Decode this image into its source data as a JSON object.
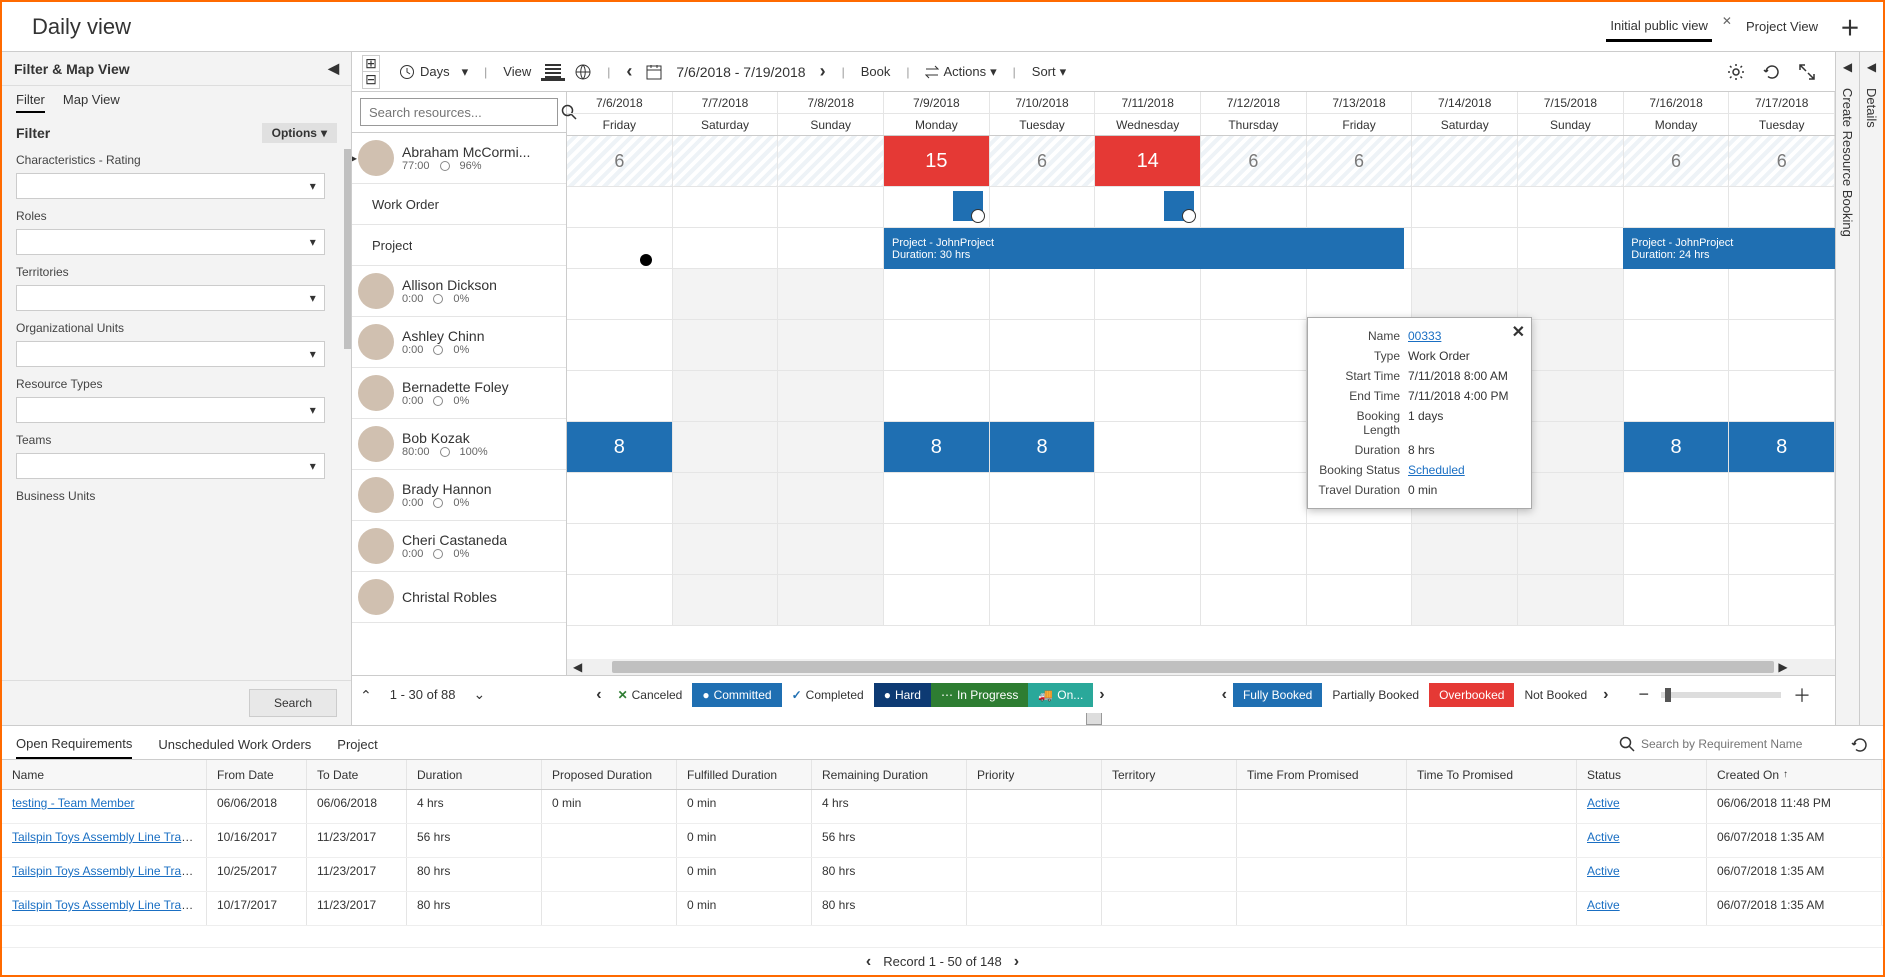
{
  "header": {
    "title": "Daily view",
    "tabs": [
      {
        "label": "Initial public view",
        "active": true,
        "closable": true
      },
      {
        "label": "Project View",
        "active": false,
        "closable": false
      }
    ]
  },
  "filterPanel": {
    "title": "Filter & Map View",
    "tabs": [
      "Filter",
      "Map View"
    ],
    "activeTab": "Filter",
    "sectionTitle": "Filter",
    "optionsLabel": "Options",
    "fields": [
      "Characteristics - Rating",
      "Roles",
      "Territories",
      "Organizational Units",
      "Resource Types",
      "Teams",
      "Business Units"
    ],
    "searchLabel": "Search"
  },
  "toolbar": {
    "timeUnit": "Days",
    "viewLabel": "View",
    "dateRange": "7/6/2018 - 7/19/2018",
    "bookLabel": "Book",
    "actionsLabel": "Actions",
    "sortLabel": "Sort"
  },
  "searchResourcesPlaceholder": "Search resources...",
  "dateColumns": [
    {
      "date": "7/6/2018",
      "day": "Friday"
    },
    {
      "date": "7/7/2018",
      "day": "Saturday"
    },
    {
      "date": "7/8/2018",
      "day": "Sunday"
    },
    {
      "date": "7/9/2018",
      "day": "Monday"
    },
    {
      "date": "7/10/2018",
      "day": "Tuesday"
    },
    {
      "date": "7/11/2018",
      "day": "Wednesday"
    },
    {
      "date": "7/12/2018",
      "day": "Thursday"
    },
    {
      "date": "7/13/2018",
      "day": "Friday"
    },
    {
      "date": "7/14/2018",
      "day": "Saturday"
    },
    {
      "date": "7/15/2018",
      "day": "Sunday"
    },
    {
      "date": "7/16/2018",
      "day": "Monday"
    },
    {
      "date": "7/17/2018",
      "day": "Tuesday"
    }
  ],
  "resources": [
    {
      "name": "Abraham McCormi...",
      "hours": "77:00",
      "pct": "96%",
      "expanded": true,
      "util": [
        "6",
        "",
        "",
        "15",
        "6",
        "14",
        "6",
        "6",
        "",
        "",
        "6",
        "6"
      ],
      "utilColor": [
        "",
        "",
        "",
        "red",
        "",
        "red",
        "",
        "",
        "",
        "",
        "",
        ""
      ],
      "subRows": [
        {
          "label": "Work Order"
        },
        {
          "label": "Project"
        }
      ]
    },
    {
      "name": "Allison Dickson",
      "hours": "0:00",
      "pct": "0%"
    },
    {
      "name": "Ashley Chinn",
      "hours": "0:00",
      "pct": "0%"
    },
    {
      "name": "Bernadette Foley",
      "hours": "0:00",
      "pct": "0%"
    },
    {
      "name": "Bob Kozak",
      "hours": "80:00",
      "pct": "100%",
      "util": [
        "8",
        "",
        "",
        "8",
        "8",
        "",
        "",
        "",
        "",
        "",
        "8",
        "8"
      ],
      "utilFill": [
        "blue",
        "gray",
        "gray",
        "blue",
        "blue",
        "",
        "",
        "",
        "gray",
        "gray",
        "blue",
        "blue"
      ]
    },
    {
      "name": "Brady Hannon",
      "hours": "0:00",
      "pct": "0%"
    },
    {
      "name": "Cheri Castaneda",
      "hours": "0:00",
      "pct": "0%"
    },
    {
      "name": "Christal Robles",
      "hours": "",
      "pct": ""
    }
  ],
  "projectBars": {
    "p1": {
      "title": "Project - JohnProject",
      "duration": "30 hrs",
      "durLabel": "Duration:"
    },
    "p2": {
      "title": "Project - JohnProject",
      "duration": "24 hrs",
      "durLabel": "Duration:"
    }
  },
  "tooltip": {
    "rows": [
      {
        "label": "Name",
        "value": "00333",
        "link": true
      },
      {
        "label": "Type",
        "value": "Work Order"
      },
      {
        "label": "Start Time",
        "value": "7/11/2018 8:00 AM"
      },
      {
        "label": "End Time",
        "value": "7/11/2018 4:00 PM"
      },
      {
        "label": "Booking Length",
        "value": "1 days"
      },
      {
        "label": "Duration",
        "value": "8 hrs"
      },
      {
        "label": "Booking Status",
        "value": "Scheduled",
        "link": true
      },
      {
        "label": "Travel Duration",
        "value": "0 min"
      }
    ]
  },
  "legend": {
    "pager": "1 - 30 of 88",
    "statuses": [
      "Canceled",
      "Committed",
      "Completed",
      "Hard",
      "In Progress",
      "On..."
    ],
    "booking": [
      "Fully Booked",
      "Partially Booked",
      "Overbooked",
      "Not Booked"
    ]
  },
  "bottom": {
    "tabs": [
      "Open Requirements",
      "Unscheduled Work Orders",
      "Project"
    ],
    "activeTab": "Open Requirements",
    "searchPlaceholder": "Search by Requirement Name",
    "columns": [
      "Name",
      "From Date",
      "To Date",
      "Duration",
      "Proposed Duration",
      "Fulfilled Duration",
      "Remaining Duration",
      "Priority",
      "Territory",
      "Time From Promised",
      "Time To Promised",
      "Status",
      "Created On"
    ],
    "rows": [
      {
        "name": "testing - Team Member",
        "from": "06/06/2018",
        "to": "06/06/2018",
        "dur": "4 hrs",
        "prop": "0 min",
        "ful": "0 min",
        "rem": "4 hrs",
        "status": "Active",
        "created": "06/06/2018 11:48 PM"
      },
      {
        "name": "Tailspin Toys Assembly Line Transfo...",
        "from": "10/16/2017",
        "to": "11/23/2017",
        "dur": "56 hrs",
        "prop": "",
        "ful": "0 min",
        "rem": "56 hrs",
        "status": "Active",
        "created": "06/07/2018 1:35 AM"
      },
      {
        "name": "Tailspin Toys Assembly Line Transfo...",
        "from": "10/25/2017",
        "to": "11/23/2017",
        "dur": "80 hrs",
        "prop": "",
        "ful": "0 min",
        "rem": "80 hrs",
        "status": "Active",
        "created": "06/07/2018 1:35 AM"
      },
      {
        "name": "Tailspin Toys Assembly Line Transfo...",
        "from": "10/17/2017",
        "to": "11/23/2017",
        "dur": "80 hrs",
        "prop": "",
        "ful": "0 min",
        "rem": "80 hrs",
        "status": "Active",
        "created": "06/07/2018 1:35 AM"
      }
    ],
    "pager": "Record 1 - 50 of 148"
  },
  "rightRails": [
    "Create Resource Booking",
    "Details"
  ]
}
